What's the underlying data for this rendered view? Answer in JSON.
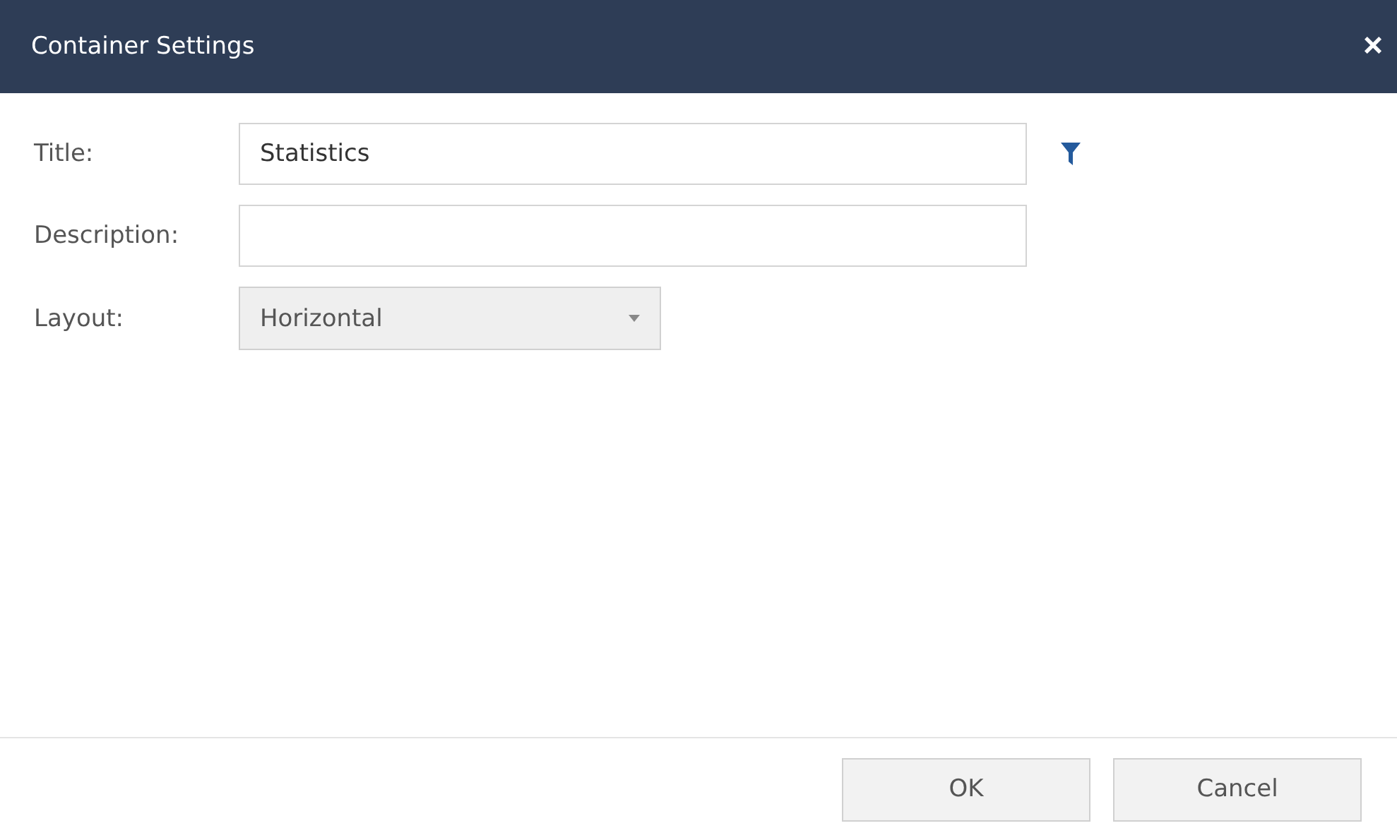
{
  "window": {
    "title": "Container Settings",
    "close": "×"
  },
  "fields": [
    {
      "kind": "text",
      "label": "Title:",
      "value": "Statistics",
      "filter": true
    },
    {
      "kind": "text",
      "label": "Description:",
      "filter": false
    },
    {
      "kind": "select",
      "label": "Layout:",
      "value": "Horizontal",
      "filter": false
    }
  ],
  "buttons": [
    "OK",
    "Cancel"
  ]
}
